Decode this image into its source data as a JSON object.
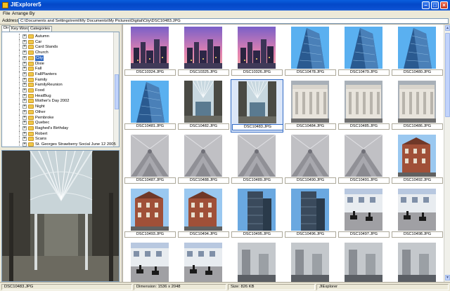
{
  "window": {
    "title": "JIExplorer5"
  },
  "menu": [
    {
      "label": "File"
    },
    {
      "label": "Arrange By"
    }
  ],
  "address": {
    "label": "Address",
    "value": "C:\\Documents and Settings\\remi\\My Documents\\My Pictures\\Digital\\City\\DSC10483.JPG"
  },
  "tabs": [
    {
      "label": "Dir"
    },
    {
      "label": "Key Words"
    },
    {
      "label": "Categories"
    }
  ],
  "tree": [
    {
      "label": "Autumn"
    },
    {
      "label": "Car"
    },
    {
      "label": "Card Stands"
    },
    {
      "label": "Church"
    },
    {
      "label": "City",
      "selected": true
    },
    {
      "label": "Dixie"
    },
    {
      "label": "Fall"
    },
    {
      "label": "FallPlanters"
    },
    {
      "label": "Family"
    },
    {
      "label": "FamilyReunion"
    },
    {
      "label": "Food"
    },
    {
      "label": "HeatBug"
    },
    {
      "label": "Mother's Day 2002"
    },
    {
      "label": "Night"
    },
    {
      "label": "Other"
    },
    {
      "label": "Pembroke"
    },
    {
      "label": "Quebec"
    },
    {
      "label": "Raghed's Birthday"
    },
    {
      "label": "Robert"
    },
    {
      "label": "Scans"
    },
    {
      "label": "St. Georges Strawberry Social June 12 2005"
    }
  ],
  "thumbnails": [
    {
      "name": "DSC10324.JPG",
      "kind": "dusk"
    },
    {
      "name": "DSC10325.JPG",
      "kind": "dusk"
    },
    {
      "name": "DSC10326.JPG",
      "kind": "dusk"
    },
    {
      "name": "DSC10478.JPG",
      "kind": "tower"
    },
    {
      "name": "DSC10479.JPG",
      "kind": "tower"
    },
    {
      "name": "DSC10480.JPG",
      "kind": "tower"
    },
    {
      "name": "DSC10481.JPG",
      "kind": "tower"
    },
    {
      "name": "DSC10482.JPG",
      "kind": "atrium"
    },
    {
      "name": "DSC10483.JPG",
      "kind": "atrium",
      "selected": true
    },
    {
      "name": "DSC10484.JPG",
      "kind": "facade"
    },
    {
      "name": "DSC10485.JPG",
      "kind": "facade"
    },
    {
      "name": "DSC10486.JPG",
      "kind": "facade"
    },
    {
      "name": "DSC10487.JPG",
      "kind": "stone"
    },
    {
      "name": "DSC10488.JPG",
      "kind": "stone"
    },
    {
      "name": "DSC10489.JPG",
      "kind": "stone"
    },
    {
      "name": "DSC10490.JPG",
      "kind": "stone"
    },
    {
      "name": "DSC10491.JPG",
      "kind": "stone"
    },
    {
      "name": "DSC10492.JPG",
      "kind": "brick"
    },
    {
      "name": "DSC10493.JPG",
      "kind": "brick"
    },
    {
      "name": "DSC10494.JPG",
      "kind": "brick"
    },
    {
      "name": "DSC10495.JPG",
      "kind": "tower2"
    },
    {
      "name": "DSC10496.JPG",
      "kind": "tower2"
    },
    {
      "name": "DSC10497.JPG",
      "kind": "horses"
    },
    {
      "name": "DSC10498.JPG",
      "kind": "horses"
    },
    {
      "name": "",
      "kind": "horses"
    },
    {
      "name": "",
      "kind": "horses"
    },
    {
      "name": "",
      "kind": "fog"
    },
    {
      "name": "",
      "kind": "fog"
    },
    {
      "name": "",
      "kind": "fog"
    },
    {
      "name": "",
      "kind": "fog"
    }
  ],
  "status": {
    "file": "DSC10483.JPG",
    "dimension": "Dimension: 1536 x 2048",
    "size": "Size: 826 KB",
    "app": "JIExplorer"
  },
  "colors": {
    "titlebar": "#0348c8",
    "selection": "#316ac5",
    "folder": "#f0c848"
  },
  "icons": [
    "app-icon",
    "minimize-icon",
    "maximize-icon",
    "close-icon",
    "folder-icon",
    "expand-icon"
  ]
}
